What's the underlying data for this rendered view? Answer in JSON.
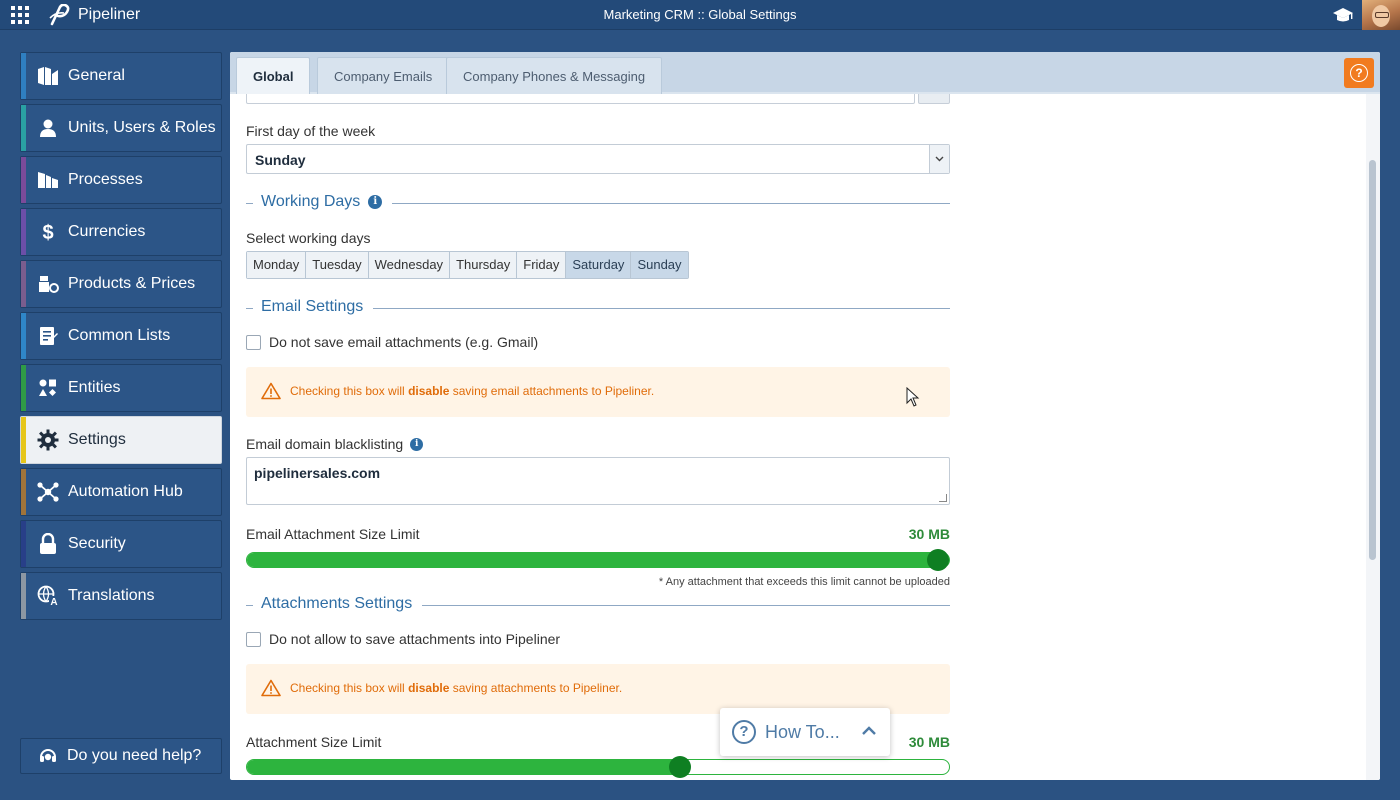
{
  "app": {
    "logo_text": "Pipeliner",
    "window_title": "Marketing CRM :: Global Settings"
  },
  "colors": {
    "brand_bg": "#2b5282",
    "accent_orange": "#f17b1f",
    "slider_green": "#2db43e",
    "link_blue": "#2e6da4"
  },
  "sidebar": {
    "items": [
      {
        "label": "General",
        "icon": "general-icon",
        "color": "#2f7fc1"
      },
      {
        "label": "Units, Users & Roles",
        "icon": "user-icon",
        "color": "#2aa1a3"
      },
      {
        "label": "Processes",
        "icon": "processes-icon",
        "color": "#7b4b9a"
      },
      {
        "label": "Currencies",
        "icon": "dollar-icon",
        "color": "#6c4fa8"
      },
      {
        "label": "Products & Prices",
        "icon": "products-icon",
        "color": "#7a5d8e"
      },
      {
        "label": "Common Lists",
        "icon": "list-icon",
        "color": "#2f86c8"
      },
      {
        "label": "Entities",
        "icon": "entities-icon",
        "color": "#2f9b46"
      },
      {
        "label": "Settings",
        "icon": "gear-icon",
        "color": "#e6c61a",
        "active": true
      },
      {
        "label": "Automation Hub",
        "icon": "automation-icon",
        "color": "#a0743a"
      },
      {
        "label": "Security",
        "icon": "lock-icon",
        "color": "#283f88"
      },
      {
        "label": "Translations",
        "icon": "translate-icon",
        "color": "#8c97a3"
      }
    ],
    "help_label": "Do you need help?"
  },
  "tabs": [
    {
      "label": "Global",
      "active": true
    },
    {
      "label": "Company Emails"
    },
    {
      "label": "Company Phones & Messaging"
    }
  ],
  "form": {
    "first_day_label": "First day of the week",
    "first_day_value": "Sunday",
    "working_days_title": "Working Days",
    "select_days_label": "Select working days",
    "days": [
      {
        "label": "Monday",
        "selected": false
      },
      {
        "label": "Tuesday",
        "selected": false
      },
      {
        "label": "Wednesday",
        "selected": false
      },
      {
        "label": "Thursday",
        "selected": false
      },
      {
        "label": "Friday",
        "selected": false
      },
      {
        "label": "Saturday",
        "selected": true
      },
      {
        "label": "Sunday",
        "selected": true
      }
    ],
    "email_settings_title": "Email Settings",
    "email_attach_checkbox": "Do not save email attachments (e.g. Gmail)",
    "email_warning": {
      "pre": "Checking this box will ",
      "bold": "disable",
      "post": " saving email attachments to Pipeliner."
    },
    "blacklist_label": "Email domain blacklisting",
    "blacklist_value": "pipelinersales.com",
    "email_limit_label": "Email Attachment Size Limit",
    "email_limit_value": "30 MB",
    "email_limit_fraction": 1.0,
    "email_limit_note": "* Any attachment that exceeds this limit cannot be uploaded",
    "attachments_title": "Attachments Settings",
    "attach_checkbox": "Do not allow to save attachments into Pipeliner",
    "attach_warning": {
      "pre": "Checking this box will ",
      "bold": "disable",
      "post": " saving attachments to Pipeliner."
    },
    "attach_limit_label": "Attachment Size Limit",
    "attach_limit_value": "30 MB",
    "attach_limit_fraction": 0.617
  },
  "howto": {
    "label": "How To..."
  }
}
